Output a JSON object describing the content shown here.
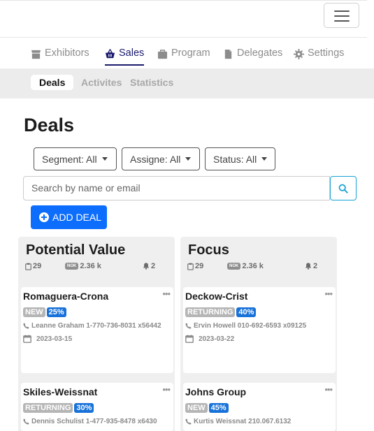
{
  "nav": {
    "items": [
      {
        "label": "Exhibitors",
        "icon": "store-icon"
      },
      {
        "label": "Sales",
        "icon": "basket-icon",
        "active": true
      },
      {
        "label": "Program",
        "icon": "briefcase-icon"
      },
      {
        "label": "Delegates",
        "icon": "document-icon"
      },
      {
        "label": "Settings",
        "icon": "gear-icon"
      }
    ]
  },
  "subnav": {
    "items": [
      {
        "label": "Deals",
        "active": true
      },
      {
        "label": "Activites"
      },
      {
        "label": "Statistics"
      }
    ]
  },
  "page": {
    "title": "Deals",
    "filters": [
      "Segment: All",
      "Assigne: All",
      "Status: All"
    ],
    "search_placeholder": "Search by name or email",
    "add_button": "ADD DEAL"
  },
  "columns": [
    {
      "title": "Potential Value",
      "count": "29",
      "currency": "NOK",
      "value": "2.36 k",
      "alerts": "2",
      "cards": [
        {
          "name": "Romaguera-Crona",
          "status": "NEW",
          "pct": "25%",
          "contact": "Leanne Graham 1-770-736-8031 x56442",
          "date": "2023-03-15"
        },
        {
          "name": "Skiles-Weissnat",
          "status": "RETURNING",
          "pct": "30%",
          "contact": "Dennis Schulist 1-477-935-8478 x6430"
        }
      ]
    },
    {
      "title": "Focus",
      "count": "29",
      "currency": "NOK",
      "value": "2.36 k",
      "alerts": "2",
      "cards": [
        {
          "name": "Deckow-Crist",
          "status": "RETURNING",
          "pct": "40%",
          "contact": "Ervin Howell 010-692-6593 x09125",
          "date": "2023-03-22"
        },
        {
          "name": "Johns Group",
          "status": "NEW",
          "pct": "45%",
          "contact": "Kurtis Weissnat 210.067.6132"
        }
      ]
    }
  ],
  "colors": {
    "accent": "#0d6efd",
    "nav_active": "#1a1a6e",
    "status_badge": "#b5b5b5",
    "pct_badge": "#1872d9"
  }
}
